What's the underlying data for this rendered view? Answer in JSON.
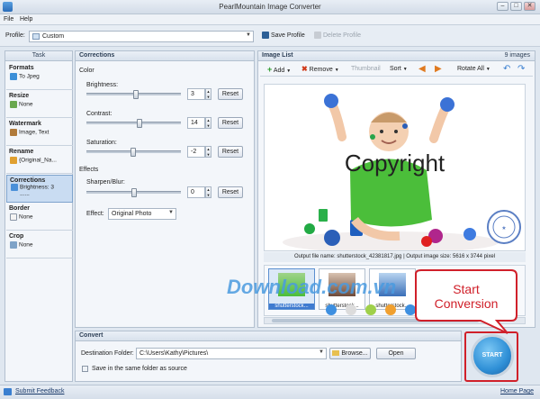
{
  "window": {
    "title": "PearlMountain Image Converter",
    "min_glyph": "–",
    "max_glyph": "□",
    "close_glyph": "✕"
  },
  "menu": {
    "file": "File",
    "help": "Help"
  },
  "profile": {
    "label": "Profile:",
    "value": "Custom",
    "save_label": "Save Profile",
    "delete_label": "Delete Profile"
  },
  "task": {
    "header": "Task",
    "sections": [
      {
        "title": "Formats",
        "value": "To Jpeg"
      },
      {
        "title": "Resize",
        "value": "None"
      },
      {
        "title": "Watermark",
        "value": "Image, Text"
      },
      {
        "title": "Rename",
        "value": "{Original_Na..."
      },
      {
        "title": "Corrections",
        "value": "Brightness: 3",
        "value2": "......"
      },
      {
        "title": "Border",
        "value": "None"
      },
      {
        "title": "Crop",
        "value": "None"
      }
    ]
  },
  "corrections": {
    "header": "Corrections",
    "color_group": "Color",
    "brightness": {
      "label": "Brightness:",
      "value": "3",
      "level": 0.53
    },
    "contrast": {
      "label": "Contrast:",
      "value": "14",
      "level": 0.57
    },
    "saturation": {
      "label": "Saturation:",
      "value": "-2",
      "level": 0.49
    },
    "reset_label": "Reset",
    "effects_group": "Effects",
    "sharpen": {
      "label": "Sharpen/Blur:",
      "value": "0",
      "level": 0.5
    },
    "effect": {
      "label": "Effect:",
      "value": "Original Photo"
    }
  },
  "image_list": {
    "header": "Image List",
    "count": "9 images",
    "toolbar": {
      "add": "Add",
      "remove": "Remove",
      "thumbnail": "Thumbnail",
      "sort": "Sort",
      "rotate": "Rotate All"
    },
    "preview_text": "Copyright",
    "output_info": "Output file name: shutterstock_42381817.jpg | Output image size: 5616 x 3744 pixel",
    "thumbs": [
      "shutterstock...",
      "shutterstock...",
      "shutterstock..."
    ]
  },
  "convert": {
    "header": "Convert",
    "dest_label": "Destination Folder:",
    "dest_value": "C:\\Users\\Kathy\\Pictures\\",
    "browse": "Browse...",
    "open": "Open",
    "same_folder": "Save in the same folder as source",
    "start": "START"
  },
  "callout": {
    "line1": "Start",
    "line2": "Conversion"
  },
  "watermark_text": "Download.com.vn",
  "footer": {
    "feedback": "Submit Feedback",
    "home": "Home Page"
  },
  "colors": {
    "accent": "#2b6fbf",
    "callout_red": "#d0202a",
    "start_blue": "#2e8fd6"
  }
}
